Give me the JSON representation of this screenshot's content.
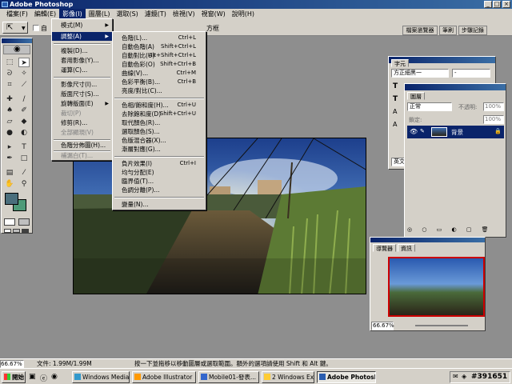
{
  "window": {
    "title": "Adobe Photoshop"
  },
  "menubar": [
    "檔案(F)",
    "編輯(E)",
    "影像(I)",
    "圖層(L)",
    "選取(S)",
    "濾鏡(T)",
    "檢視(V)",
    "視窗(W)",
    "說明(H)"
  ],
  "optbar": {
    "checkbox_label": "自",
    "bounds_label": "方框",
    "tabs": [
      "檔案瀏覽器",
      "筆刷",
      "步驟記錄"
    ]
  },
  "image_menu": {
    "items": [
      "模式(M)",
      "調整(A)",
      "複製(D)...",
      "套用影像(Y)...",
      "運算(C)...",
      "影像尺寸(I)...",
      "版面尺寸(S)...",
      "旋轉版面(E)",
      "裁切(P)",
      "修剪(R)...",
      "全部顯現(V)",
      "色階分佈圖(H)...",
      "補漏白(T)..."
    ]
  },
  "adjust_menu": {
    "items": [
      {
        "label": "色階(L)...",
        "shortcut": "Ctrl+L"
      },
      {
        "label": "自動色階(A)",
        "shortcut": "Shift+Ctrl+L"
      },
      {
        "label": "自動對比(U)",
        "shortcut": "Alt+Shift+Ctrl+L"
      },
      {
        "label": "自動色彩(O)",
        "shortcut": "Shift+Ctrl+B"
      },
      {
        "label": "曲線(V)...",
        "shortcut": "Ctrl+M"
      },
      {
        "label": "色彩平衡(B)...",
        "shortcut": "Ctrl+B"
      },
      {
        "label": "亮度/對比(C)...",
        "shortcut": ""
      },
      {
        "label": "色相/飽和度(H)...",
        "shortcut": "Ctrl+U"
      },
      {
        "label": "去除飽和度(D)",
        "shortcut": "Shift+Ctrl+U"
      },
      {
        "label": "取代顏色(R)...",
        "shortcut": ""
      },
      {
        "label": "選取顏色(S)...",
        "shortcut": ""
      },
      {
        "label": "色版混合器(X)...",
        "shortcut": ""
      },
      {
        "label": "漸層對應(G)...",
        "shortcut": ""
      },
      {
        "label": "負片效果(I)",
        "shortcut": "Ctrl+I"
      },
      {
        "label": "均勻分配(E)",
        "shortcut": ""
      },
      {
        "label": "臨界值(T)...",
        "shortcut": ""
      },
      {
        "label": "色調分離(P)...",
        "shortcut": ""
      },
      {
        "label": "變量(N)...",
        "shortcut": ""
      }
    ]
  },
  "char_panel": {
    "tab": "字元",
    "font": "方正細黑一",
    "style": "-",
    "lang": "英文"
  },
  "layers_panel": {
    "tab": "圖層",
    "blend": "正常",
    "opacity_label": "不透明:",
    "opacity": "100%",
    "lock_label": "鎖定:",
    "fill": "100%",
    "layer_name": "背景"
  },
  "navigator": {
    "tabs": [
      "導覽器",
      "資訊"
    ],
    "zoom": "66.67%"
  },
  "status": {
    "zoom": "66.67%",
    "doc": "文件: 1.99M/1.99M",
    "hint": "按一下並拖移以移動圖層或選取範圍。額外的選項請使用 Shift 和 Alt 鍵。"
  },
  "taskbar": {
    "start": "開始",
    "tasks": [
      "Windows Media ...",
      "Adobe Illustrator",
      "Mobile01-發表...",
      "2 Windows Ex...",
      "Adobe Photoshop"
    ],
    "clock": "#391651"
  }
}
